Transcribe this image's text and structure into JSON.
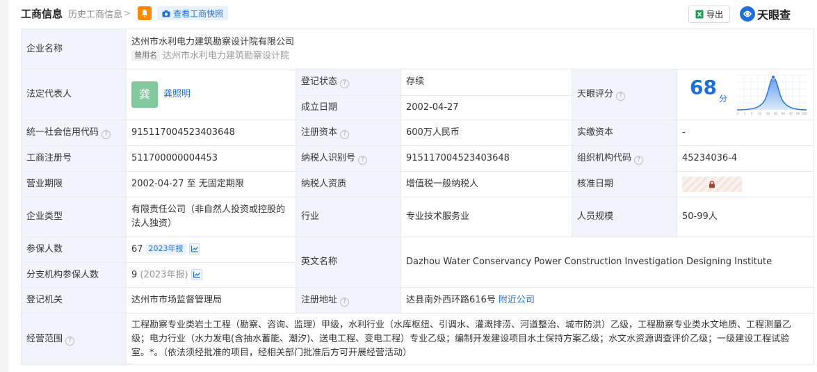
{
  "header": {
    "title": "工商信息",
    "history_label": "历史工商信息",
    "history_chevron": ">",
    "snapshot_label": "查看工商快照",
    "export_label": "导出",
    "brand_label": "天眼查"
  },
  "rows": {
    "company_name": {
      "label": "企业名称",
      "value": "达州市水利电力建筑勘察设计院有限公司",
      "old_tag": "曾用名",
      "old_name": "达州市水利电力建筑勘察设计院"
    },
    "legal_rep": {
      "label": "法定代表人",
      "avatar_char": "龚",
      "name": "龚照明"
    },
    "reg_status": {
      "label": "登记状态",
      "value": "存续"
    },
    "found_date": {
      "label": "成立日期",
      "value": "2002-04-27"
    },
    "score": {
      "label": "天眼评分",
      "value": "68",
      "unit": "分",
      "axis_ticks": [
        "0",
        "1",
        "5",
        "10",
        "50",
        "80",
        "90",
        "97",
        "99",
        "100"
      ]
    },
    "credit_code": {
      "label": "统一社会信用代码",
      "value": "915117004523403648"
    },
    "reg_capital": {
      "label": "注册资本",
      "value": "600万人民币"
    },
    "paid_capital": {
      "label": "实缴资本",
      "value": "-"
    },
    "reg_no": {
      "label": "工商注册号",
      "value": "511700000004453"
    },
    "taxpayer_id": {
      "label": "纳税人识别号",
      "value": "915117004523403648"
    },
    "org_code": {
      "label": "组织机构代码",
      "value": "45234036-4"
    },
    "term": {
      "label": "营业期限",
      "value": "2002-04-27 至 无固定期限"
    },
    "taxpayer_qual": {
      "label": "纳税人资质",
      "value": "增值税一般纳税人"
    },
    "approval_date": {
      "label": "核准日期"
    },
    "company_type": {
      "label": "企业类型",
      "value_line1": "有限责任公司（非自然人投资或控股的",
      "value_line2": "法人独资）"
    },
    "industry": {
      "label": "行业",
      "value": "专业技术服务业"
    },
    "staff_size": {
      "label": "人员规模",
      "value": "50-99人"
    },
    "insured": {
      "label": "参保人数",
      "value": "67",
      "report_tag": "2023年报"
    },
    "english_name": {
      "label": "英文名称",
      "value": "Dazhou Water Conservancy Power Construction Investigation Designing Institute"
    },
    "branch_insured": {
      "label": "分支机构参保人数",
      "value": "9",
      "note": "(2023年报)"
    },
    "authority": {
      "label": "登记机关",
      "value": "达州市市场监督管理局"
    },
    "address": {
      "label": "注册地址",
      "value": "达县南外西环路616号",
      "nearby": "附近公司"
    },
    "scope": {
      "label": "经营范围",
      "line1": "工程勘察专业类岩土工程（勘察、咨询、监理）甲级，水利行业（水库枢纽、引调水、灌溉排涝、河道整治、城市防洪）乙级，工程勘察专业类水文地质、工程测量乙",
      "line2": "级；电力行业（水力发电(含抽水蓄能、潮汐)、送电工程、变电工程）专业乙级；编制开发建设项目水土保持方案乙级；水文水资源调查评价乙级；一级建设工程试验",
      "line3": "室。*。（依法须经批准的项目，经相关部门批准后方可开展经营活动）"
    }
  },
  "colors": {
    "accent": "#1f6fd8",
    "status_green": "#1e9c55",
    "label_bg": "#f1f5fb",
    "bell_orange": "#ff8a00"
  },
  "icons": [
    "bell-icon",
    "camera-icon",
    "excel-icon",
    "brand-logo-icon",
    "help-icon",
    "trend-chart-icon",
    "lock-icon"
  ]
}
